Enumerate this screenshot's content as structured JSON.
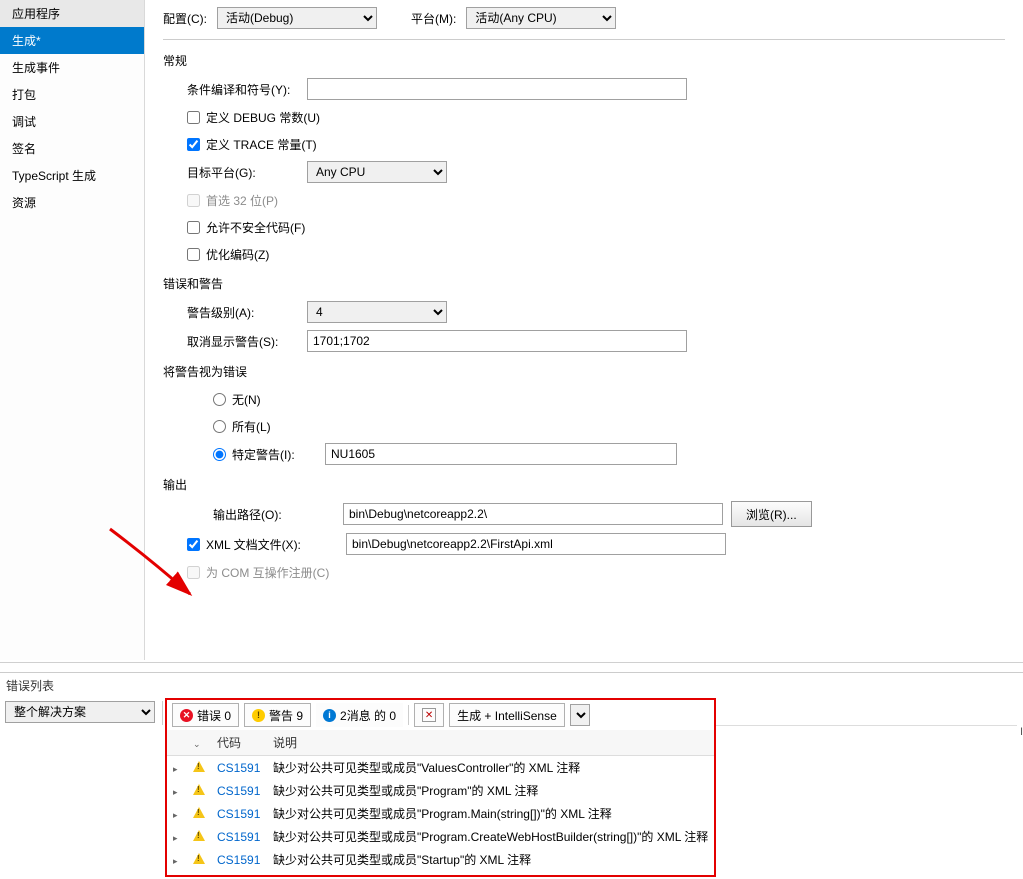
{
  "sidebar": {
    "items": [
      {
        "label": "应用程序"
      },
      {
        "label": "生成*"
      },
      {
        "label": "生成事件"
      },
      {
        "label": "打包"
      },
      {
        "label": "调试"
      },
      {
        "label": "签名"
      },
      {
        "label": "TypeScript 生成"
      },
      {
        "label": "资源"
      }
    ],
    "selected_index": 1
  },
  "config_bar": {
    "config_label": "配置(C):",
    "config_value": "活动(Debug)",
    "platform_label": "平台(M):",
    "platform_value": "活动(Any CPU)"
  },
  "sections": {
    "general": "常规",
    "errors_warnings": "错误和警告",
    "treat_as_errors": "将警告视为错误",
    "output": "输出"
  },
  "fields": {
    "conditional_symbols": "条件编译和符号(Y):",
    "define_debug": "定义 DEBUG 常数(U)",
    "define_trace": "定义 TRACE 常量(T)",
    "target_platform": "目标平台(G):",
    "target_platform_value": "Any CPU",
    "prefer32": "首选 32 位(P)",
    "allow_unsafe": "允许不安全代码(F)",
    "optimize": "优化编码(Z)",
    "warning_level": "警告级别(A):",
    "warning_level_value": "4",
    "suppress_warnings": "取消显示警告(S):",
    "suppress_warnings_value": "1701;1702",
    "treat_none": "无(N)",
    "treat_all": "所有(L)",
    "treat_specific": "特定警告(I):",
    "treat_specific_value": "NU1605",
    "output_path": "输出路径(O):",
    "output_path_value": "bin\\Debug\\netcoreapp2.2\\",
    "browse_btn": "浏览(R)...",
    "xml_doc": "XML 文档文件(X):",
    "xml_doc_value": "bin\\Debug\\netcoreapp2.2\\FirstApi.xml",
    "com_interop": "为 COM 互操作注册(C)"
  },
  "error_panel": {
    "title": "错误列表",
    "scope_value": "整个解决方案",
    "errors_btn": "错误 0",
    "warnings_btn": "警告 9",
    "info_btn": "2消息 的 0",
    "build_intelli": "生成 + IntelliSense",
    "col_code": "代码",
    "col_desc": "说明",
    "rows": [
      {
        "code": "CS1591",
        "desc": "缺少对公共可见类型或成员\"ValuesController\"的 XML 注释"
      },
      {
        "code": "CS1591",
        "desc": "缺少对公共可见类型或成员\"Program\"的 XML 注释"
      },
      {
        "code": "CS1591",
        "desc": "缺少对公共可见类型或成员\"Program.Main(string[])\"的 XML 注释"
      },
      {
        "code": "CS1591",
        "desc": "缺少对公共可见类型或成员\"Program.CreateWebHostBuilder(string[])\"的 XML 注释"
      },
      {
        "code": "CS1591",
        "desc": "缺少对公共可见类型或成员\"Startup\"的 XML 注释"
      }
    ]
  }
}
